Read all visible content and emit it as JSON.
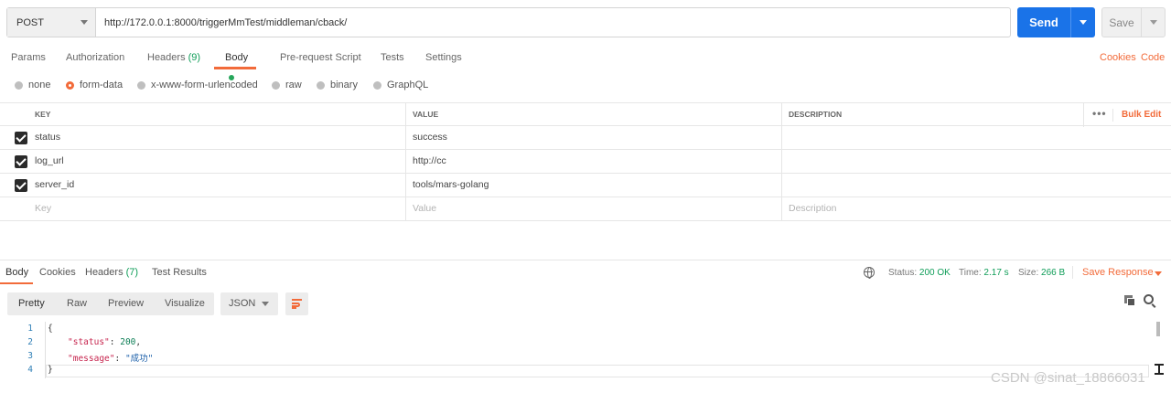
{
  "request": {
    "method": "POST",
    "url": "http://172.0.0.1:8000/triggerMmTest/middleman/cback/",
    "send_label": "Send",
    "save_label": "Save"
  },
  "request_tabs": {
    "params": "Params",
    "authorization": "Authorization",
    "headers": "Headers",
    "headers_count": "(9)",
    "body": "Body",
    "prerequest": "Pre-request Script",
    "tests": "Tests",
    "settings": "Settings",
    "cookies": "Cookies",
    "code": "Code",
    "active": "Body"
  },
  "body_types": {
    "none": "none",
    "form_data": "form-data",
    "urlencoded": "x-www-form-urlencoded",
    "raw": "raw",
    "binary": "binary",
    "graphql": "GraphQL",
    "selected": "form-data"
  },
  "params_table": {
    "headers": {
      "key": "KEY",
      "value": "VALUE",
      "description": "DESCRIPTION"
    },
    "more_label": "•••",
    "bulk_edit": "Bulk Edit",
    "rows": [
      {
        "checked": true,
        "key": "status",
        "value": "success",
        "description": ""
      },
      {
        "checked": true,
        "key": "log_url",
        "value": "http://cc",
        "description": ""
      },
      {
        "checked": true,
        "key": "server_id",
        "value": "tools/mars-golang",
        "description": ""
      }
    ],
    "placeholders": {
      "key": "Key",
      "value": "Value",
      "description": "Description"
    }
  },
  "response": {
    "tabs": {
      "body": "Body",
      "cookies": "Cookies",
      "headers": "Headers",
      "headers_count": "(7)",
      "test_results": "Test Results"
    },
    "status_label": "Status:",
    "status_value": "200 OK",
    "time_label": "Time:",
    "time_value": "2.17 s",
    "size_label": "Size:",
    "size_value": "266 B",
    "save_response": "Save Response",
    "views": {
      "pretty": "Pretty",
      "raw": "Raw",
      "preview": "Preview",
      "visualize": "Visualize"
    },
    "format": "JSON",
    "code_lines": {
      "l1": "{",
      "l2_key": "\"status\"",
      "l2_val": "200",
      "l3_key": "\"message\"",
      "l3_val": "\"成功\"",
      "l4": "}"
    },
    "line_numbers": [
      "1",
      "2",
      "3",
      "4"
    ]
  },
  "colors": {
    "accent": "#f26b3a",
    "send_blue": "#1a73e8",
    "status_green": "#0f9d58"
  },
  "watermark": "CSDN @sinat_18866031"
}
